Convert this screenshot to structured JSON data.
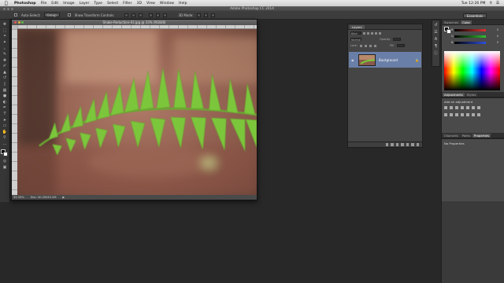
{
  "menubar": {
    "apple": "",
    "app": "Photoshop",
    "items": [
      "File",
      "Edit",
      "Image",
      "Layer",
      "Type",
      "Select",
      "Filter",
      "3D",
      "View",
      "Window",
      "Help"
    ],
    "clock": "Tue 12:26 PM"
  },
  "titlebar": {
    "title": "Adobe Photoshop CC 2014"
  },
  "options": {
    "auto_select_label": "Auto-Select:",
    "auto_select_value": "Group",
    "show_transform_label": "Show Transform Controls",
    "mode_3d_label": "3D Mode:",
    "workspace": "Essentials"
  },
  "document": {
    "title": "Shake-Reduction-03.jpg @ 33% (RGB/8)",
    "zoom": "33.33%",
    "doc_size": "Doc: 40.2M/40.2M"
  },
  "layers": {
    "tab": "Layers",
    "filter_kind": "Kind",
    "blend_mode": "Normal",
    "opacity_label": "Opacity:",
    "lock_label": "Lock:",
    "fill_label": "Fill:",
    "layer_name": "Background"
  },
  "right": {
    "tabs_color": [
      "Swatches",
      "Color"
    ],
    "sliders": [
      {
        "label": "R",
        "value": "0",
        "color": "#e03030"
      },
      {
        "label": "G",
        "value": "0",
        "color": "#30c030"
      },
      {
        "label": "B",
        "value": "0",
        "color": "#3050e0"
      }
    ],
    "tabs_adj": [
      "Adjustments",
      "Styles"
    ],
    "add_adjustment": "Add an adjustment",
    "tabs_props": [
      "Channels",
      "Paths",
      "Properties"
    ],
    "no_properties": "No Properties"
  },
  "colors": {
    "accent_layer": "#6a7fa8",
    "fern_green": "#7cc63a"
  }
}
